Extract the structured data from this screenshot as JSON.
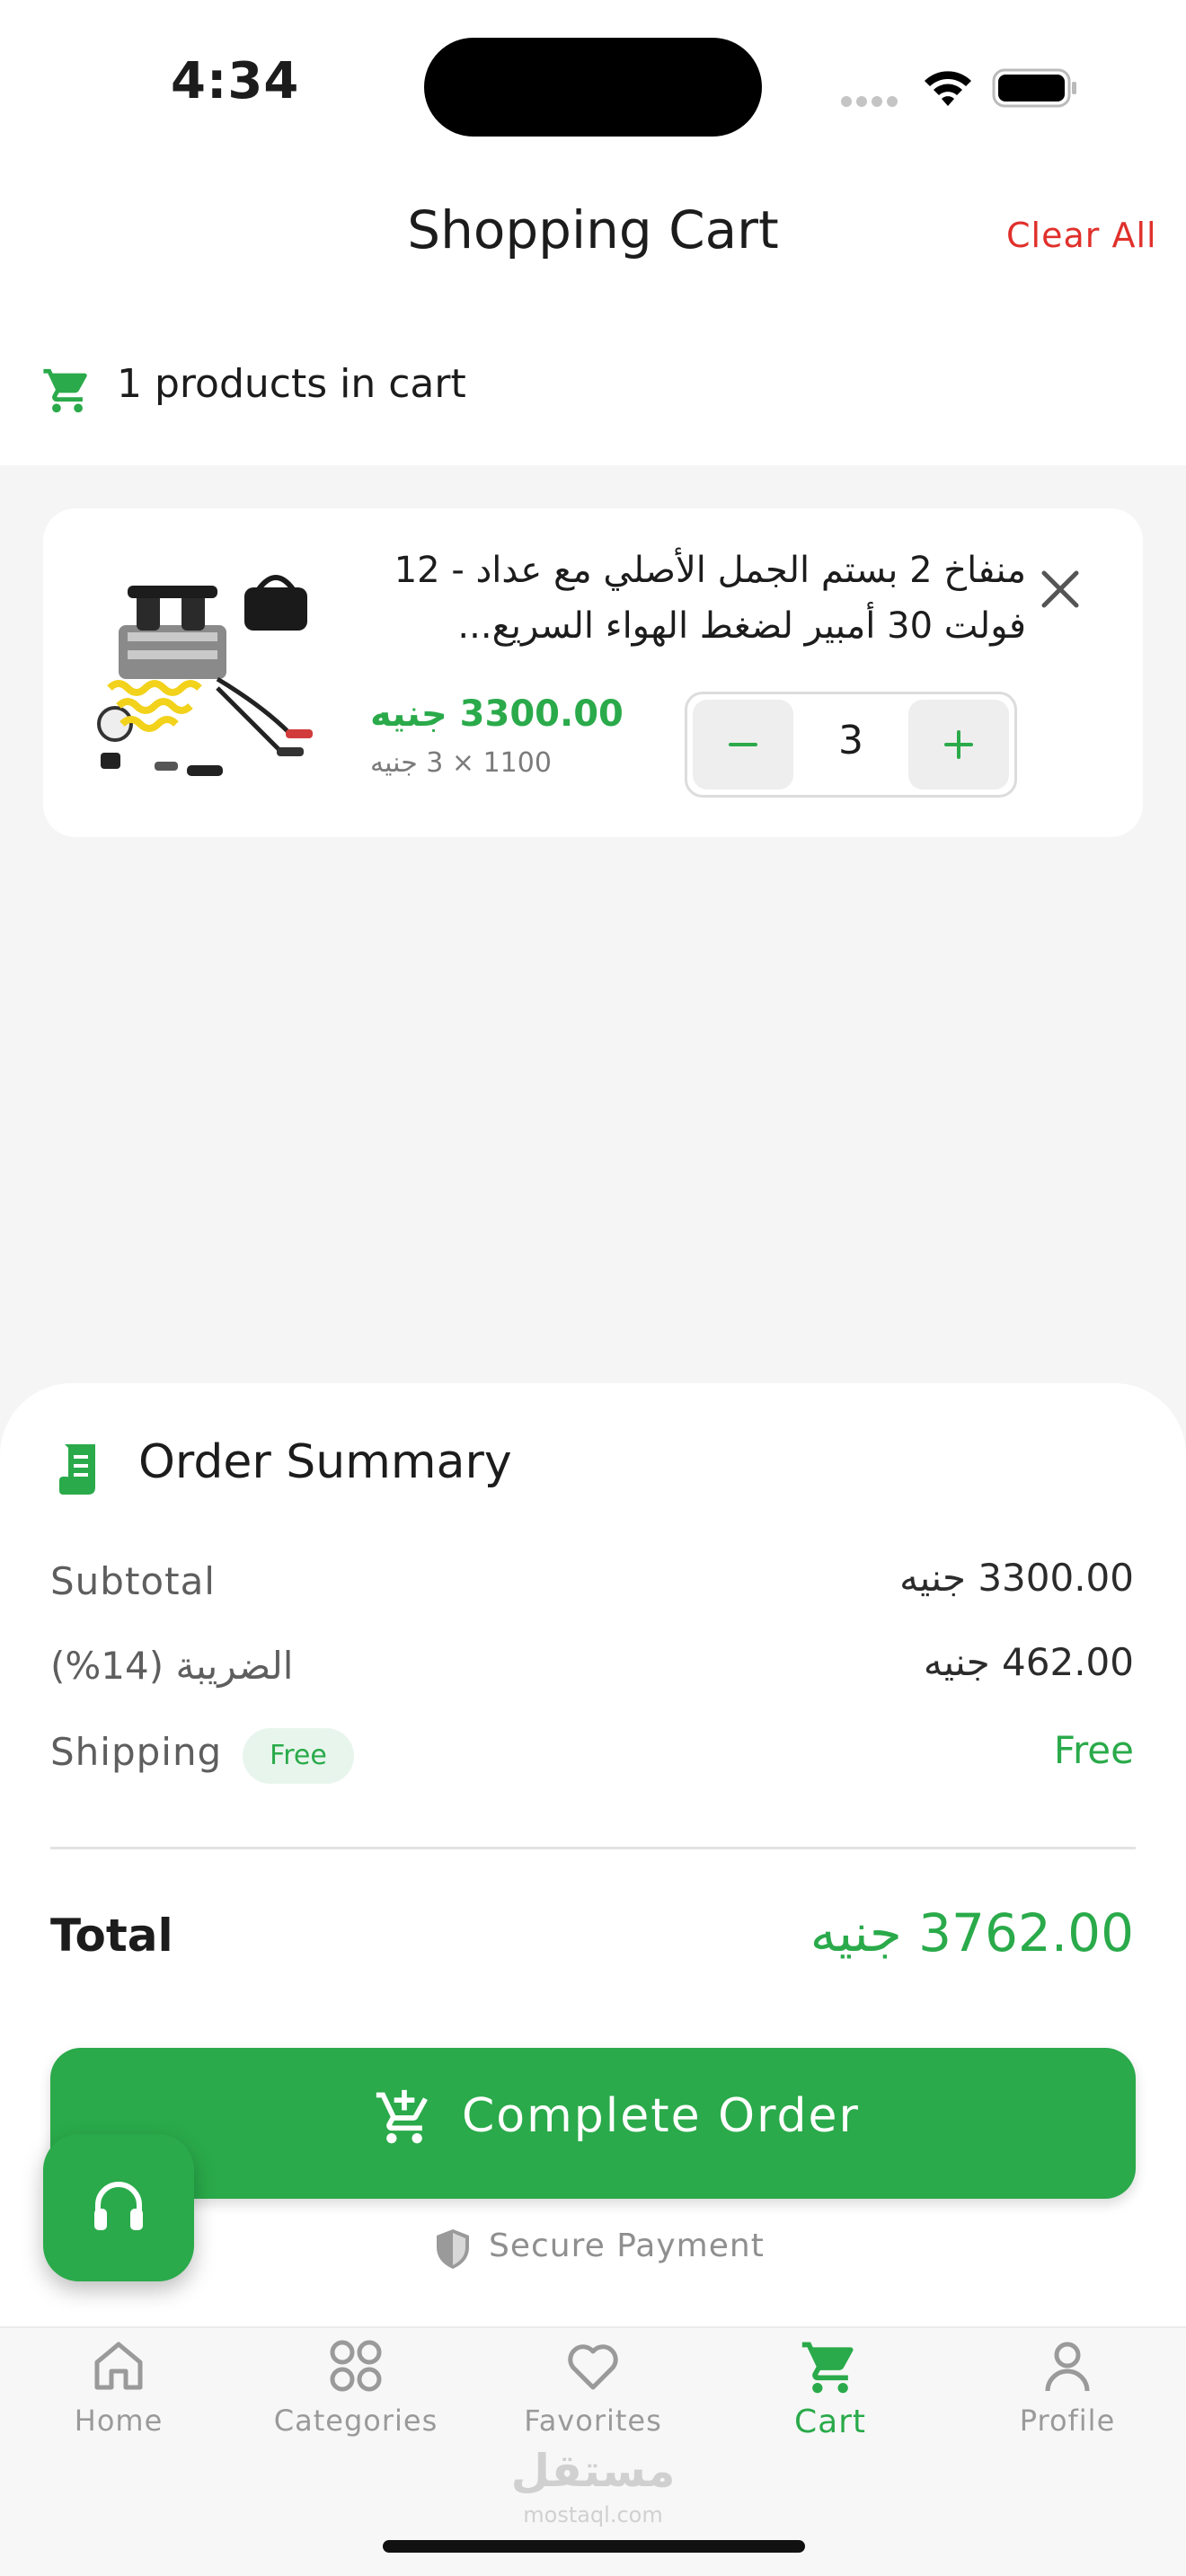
{
  "status_bar": {
    "time": "4:34"
  },
  "header": {
    "title": "Shopping Cart",
    "clear_all_label": "Clear All"
  },
  "cart_count_text": "1 products in cart",
  "cart_items": [
    {
      "name": "منفاخ 2 بستم الجمل الأصلي مع عداد - 12 فولت 30 أمبير لضغط الهواء السريع...",
      "item_total": "3300.00 جنيه",
      "unit_price": "1100 × 3 جنيه",
      "quantity": "3",
      "image_icon": "air-compressor-image"
    }
  ],
  "order_summary": {
    "title": "Order Summary",
    "subtotal_label": "Subtotal",
    "subtotal_value": "3300.00 جنيه",
    "tax_label": "الضريبة (14%)",
    "tax_value": "462.00 جنيه",
    "shipping_label": "Shipping",
    "shipping_badge": "Free",
    "shipping_value": "Free",
    "total_label": "Total",
    "total_value": "3762.00 جنيه"
  },
  "checkout": {
    "button_label": "Complete Order",
    "secure_label": "Secure Payment"
  },
  "tabs": [
    {
      "label": "Home",
      "icon": "home-icon"
    },
    {
      "label": "Categories",
      "icon": "categories-icon"
    },
    {
      "label": "Favorites",
      "icon": "heart-icon"
    },
    {
      "label": "Cart",
      "icon": "cart-icon",
      "active": true
    },
    {
      "label": "Profile",
      "icon": "profile-icon"
    }
  ],
  "watermark": {
    "arabic": "مستقل",
    "latin": "mostaql.com"
  },
  "colors": {
    "accent": "#2aaa4a",
    "danger": "#e0302b",
    "background": "#f5f5f5"
  }
}
